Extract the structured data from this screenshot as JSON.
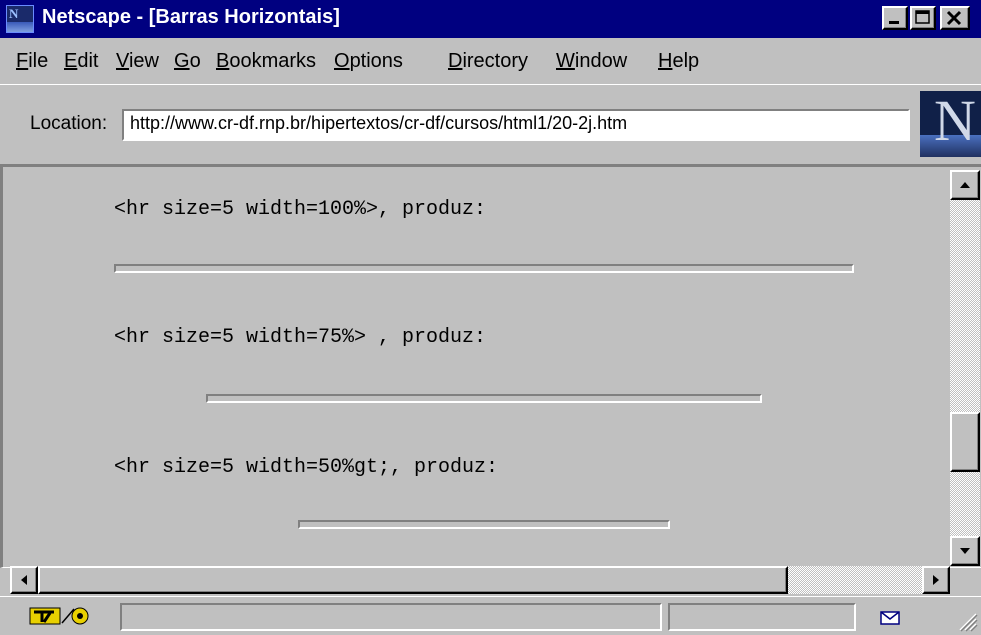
{
  "window": {
    "title": "Netscape - [Barras Horizontais]",
    "controls": [
      "minimize",
      "maximize",
      "close"
    ]
  },
  "menu": {
    "items": [
      {
        "label": "File",
        "mnemonic": "F"
      },
      {
        "label": "Edit",
        "mnemonic": "E"
      },
      {
        "label": "View",
        "mnemonic": "V"
      },
      {
        "label": "Go",
        "mnemonic": "G"
      },
      {
        "label": "Bookmarks",
        "mnemonic": "B"
      },
      {
        "label": "Options",
        "mnemonic": "O"
      },
      {
        "label": "Directory",
        "mnemonic": "D"
      },
      {
        "label": "Window",
        "mnemonic": "W"
      },
      {
        "label": "Help",
        "mnemonic": "H"
      }
    ]
  },
  "location": {
    "label": "Location:",
    "url": "http://www.cr-df.rnp.br/hipertextos/cr-df/cursos/html1/20-2j.htm"
  },
  "logo": {
    "letter": "N"
  },
  "content": {
    "lines": [
      {
        "code": "<hr size=5 width=100%>, produz:",
        "rule_width_percent": 100
      },
      {
        "code": "<hr size=5 width=75%> , produz:",
        "rule_width_percent": 75
      },
      {
        "code": "<hr size=5 width=50%gt;, produz:",
        "rule_width_percent": 50
      }
    ]
  },
  "icons": {
    "app": "netscape-icon",
    "security": "security-key-icon",
    "mail": "mail-icon",
    "resize": "resize-grip-icon"
  },
  "colors": {
    "titlebar": "#000080",
    "chrome": "#c0c0c0",
    "field": "#ffffff"
  }
}
